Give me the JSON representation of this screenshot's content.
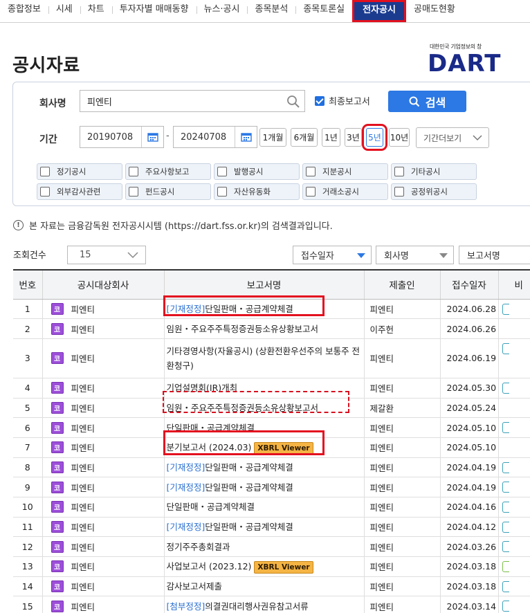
{
  "topnav": {
    "tabs": [
      {
        "label": "종합정보",
        "active": false
      },
      {
        "label": "시세",
        "active": false
      },
      {
        "label": "차트",
        "active": false
      },
      {
        "label": "투자자별 매매동향",
        "active": false
      },
      {
        "label": "뉴스·공시",
        "active": false
      },
      {
        "label": "종목분석",
        "active": false
      },
      {
        "label": "종목토론실",
        "active": false
      },
      {
        "label": "전자공시",
        "active": true
      },
      {
        "label": "공매도현황",
        "active": false
      }
    ]
  },
  "page": {
    "title": "공시자료",
    "logo_tagline": "대한민국 기업정보의 창",
    "logo_text": "DART"
  },
  "search": {
    "company_label": "회사명",
    "company_value": "피엔티",
    "latest_report_label": "최종보고서",
    "latest_report_checked": true,
    "search_button": "검색",
    "period_label": "기간",
    "start_date": "20190708",
    "end_date": "20240708",
    "date_separator": "-",
    "period_buttons": [
      "1개월",
      "6개월",
      "1년",
      "3년",
      "5년",
      "10년"
    ],
    "selected_period": "5년",
    "more_period": "기간더보기",
    "types": [
      "정기공시",
      "주요사항보고",
      "발행공시",
      "지분공시",
      "기타공시",
      "외부감사관련",
      "펀드공시",
      "자산유동화",
      "거래소공시",
      "공정위공시"
    ]
  },
  "notice": "본 자료는 금융감독원 전자공시시템 (https://dart.fss.or.kr)의 검색결과입니다.",
  "list_controls": {
    "count_label": "조회건수",
    "count_value": "15",
    "sort_options": [
      "접수일자",
      "회사명",
      "보고서명"
    ]
  },
  "table": {
    "headers": [
      "번호",
      "공시대상회사",
      "보고서명",
      "제출인",
      "접수일자",
      "비"
    ],
    "corp_badge": "코",
    "xbrl_label": "XBRL Viewer",
    "rows": [
      {
        "no": "1",
        "company": "피엔티",
        "prefix": "[기재정정]",
        "report": "단일판매・공급계약체결",
        "xbrl": false,
        "submitter": "피엔티",
        "date": "2024.06.28",
        "stub": "blue"
      },
      {
        "no": "2",
        "company": "피엔티",
        "prefix": "",
        "report": "임원・주요주주특정증권등소유상황보고서",
        "xbrl": false,
        "submitter": "이주헌",
        "date": "2024.06.26",
        "stub": ""
      },
      {
        "no": "3",
        "company": "피엔티",
        "prefix": "",
        "report": "기타경영사항(자율공시) (상환전환우선주의 보통주 전환청구)",
        "xbrl": false,
        "submitter": "피엔티",
        "date": "2024.06.19",
        "stub": "blue"
      },
      {
        "no": "4",
        "company": "피엔티",
        "prefix": "",
        "report": "기업설명회(IR)개최",
        "xbrl": false,
        "submitter": "피엔티",
        "date": "2024.05.30",
        "stub": "blue"
      },
      {
        "no": "5",
        "company": "피엔티",
        "prefix": "",
        "report": "임원・주요주주특정증권등소유상황보고서",
        "xbrl": false,
        "submitter": "제갈환",
        "date": "2024.05.24",
        "stub": ""
      },
      {
        "no": "6",
        "company": "피엔티",
        "prefix": "",
        "report": "단일판매・공급계약체결",
        "xbrl": false,
        "submitter": "피엔티",
        "date": "2024.05.10",
        "stub": "blue"
      },
      {
        "no": "7",
        "company": "피엔티",
        "prefix": "",
        "report": "분기보고서 (2024.03)",
        "xbrl": true,
        "submitter": "피엔티",
        "date": "2024.05.10",
        "stub": ""
      },
      {
        "no": "8",
        "company": "피엔티",
        "prefix": "[기재정정]",
        "report": "단일판매・공급계약체결",
        "xbrl": false,
        "submitter": "피엔티",
        "date": "2024.04.19",
        "stub": "blue"
      },
      {
        "no": "9",
        "company": "피엔티",
        "prefix": "[기재정정]",
        "report": "단일판매・공급계약체결",
        "xbrl": false,
        "submitter": "피엔티",
        "date": "2024.04.19",
        "stub": "blue"
      },
      {
        "no": "10",
        "company": "피엔티",
        "prefix": "",
        "report": "단일판매・공급계약체결",
        "xbrl": false,
        "submitter": "피엔티",
        "date": "2024.04.16",
        "stub": "blue"
      },
      {
        "no": "11",
        "company": "피엔티",
        "prefix": "[기재정정]",
        "report": "단일판매・공급계약체결",
        "xbrl": false,
        "submitter": "피엔티",
        "date": "2024.04.12",
        "stub": "blue"
      },
      {
        "no": "12",
        "company": "피엔티",
        "prefix": "",
        "report": "정기주주총회결과",
        "xbrl": false,
        "submitter": "피엔티",
        "date": "2024.03.26",
        "stub": "blue"
      },
      {
        "no": "13",
        "company": "피엔티",
        "prefix": "",
        "report": "사업보고서 (2023.12)",
        "xbrl": true,
        "submitter": "피엔티",
        "date": "2024.03.18",
        "stub": "green"
      },
      {
        "no": "14",
        "company": "피엔티",
        "prefix": "",
        "report": "감사보고서제출",
        "xbrl": false,
        "submitter": "피엔티",
        "date": "2024.03.18",
        "stub": "blue"
      },
      {
        "no": "15",
        "company": "피엔티",
        "prefix": "[첨부정정]",
        "report": "의결권대리행사권유참고서류",
        "xbrl": false,
        "submitter": "피엔티",
        "date": "2024.03.14",
        "stub": "blue"
      }
    ]
  },
  "colors": {
    "accent": "#2c78e4",
    "nav_active": "#1b3b8f",
    "highlight": "#e3101f",
    "corp_badge": "#9c4fd8",
    "xbrl_badge": "#f5b545",
    "link_prefix": "#2a6fd1",
    "logo": "#1a2a88"
  },
  "icons": {
    "search": "magnifier-icon",
    "calendar": "calendar-icon",
    "info": "info-icon",
    "dropdown": "chevron-down-icon"
  }
}
